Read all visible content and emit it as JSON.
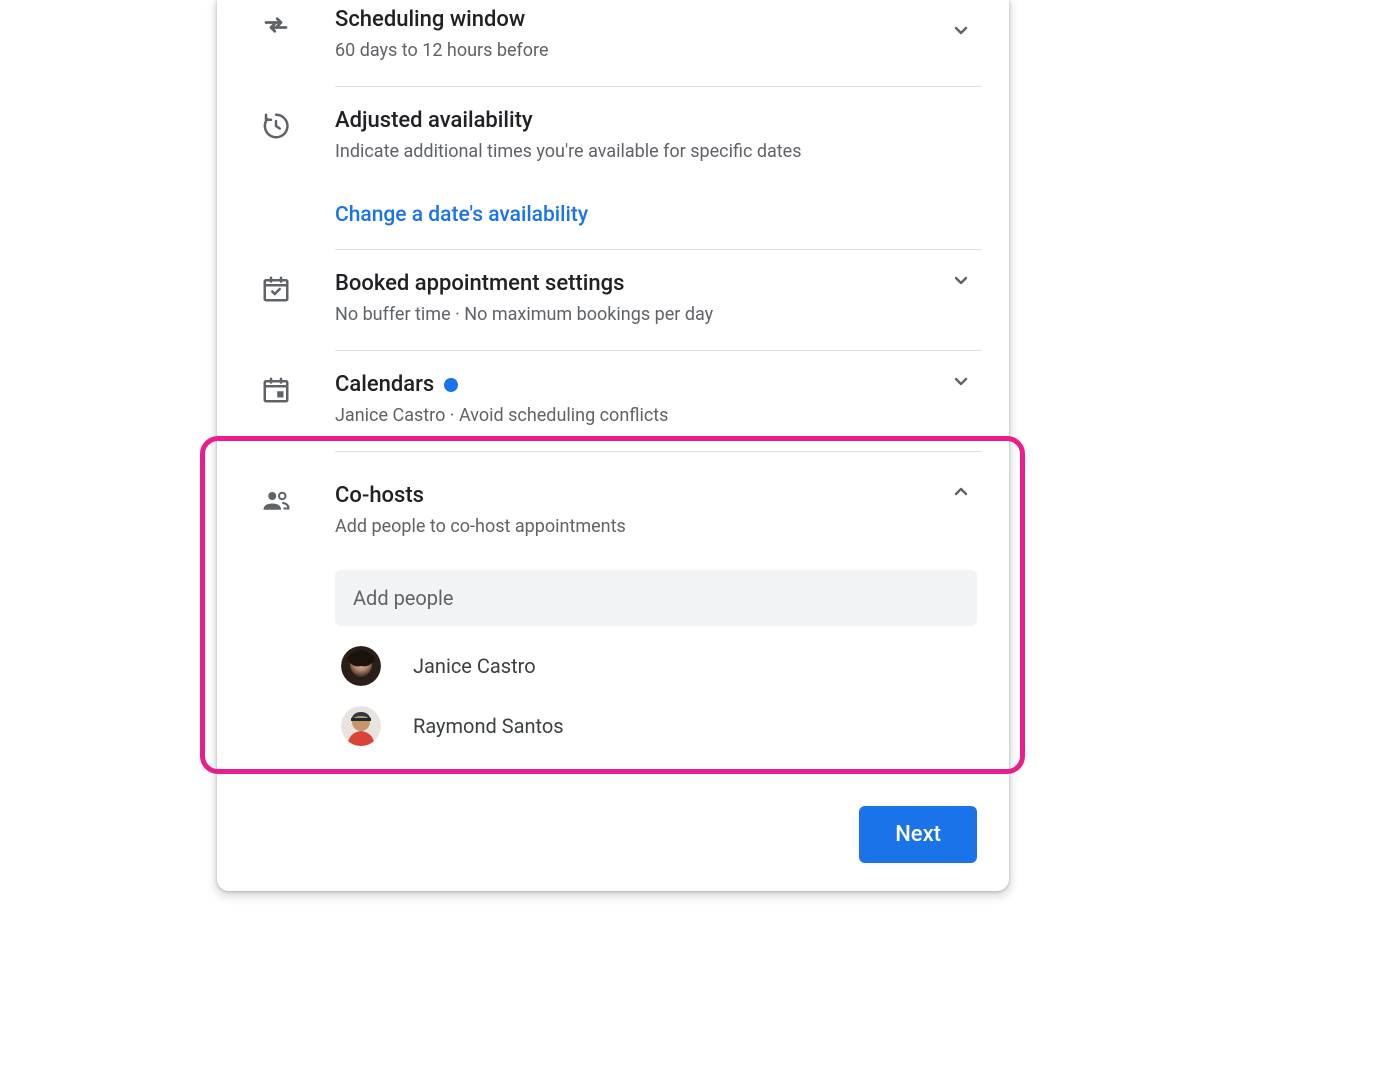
{
  "sections": {
    "scheduling_window": {
      "title": "Scheduling window",
      "subtitle": "60 days to 12 hours before"
    },
    "adjusted_availability": {
      "title": "Adjusted availability",
      "subtitle": "Indicate additional times you're available for specific dates",
      "action_label": "Change a date's availability"
    },
    "booked_settings": {
      "title": "Booked appointment settings",
      "subtitle": "No buffer time · No maximum bookings per day"
    },
    "calendars": {
      "title": "Calendars",
      "subtitle": "Janice Castro · Avoid scheduling conflicts"
    },
    "cohosts": {
      "title": "Co-hosts",
      "subtitle": "Add people to co-host appointments",
      "input_placeholder": "Add people",
      "people": [
        {
          "name": "Janice Castro"
        },
        {
          "name": "Raymond Santos"
        }
      ]
    }
  },
  "footer": {
    "next_label": "Next"
  }
}
